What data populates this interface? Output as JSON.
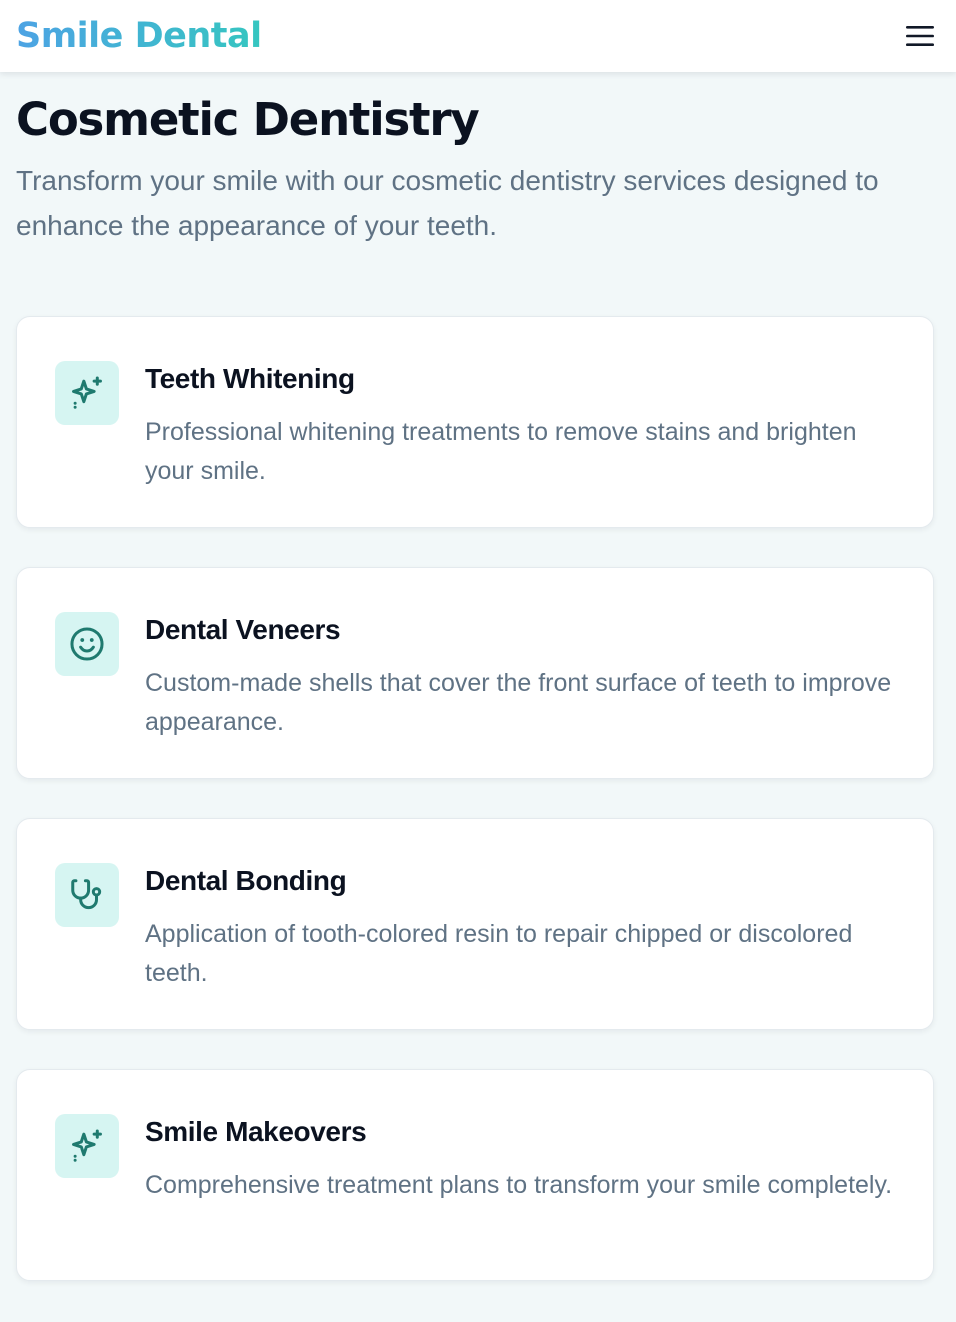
{
  "header": {
    "brand": "Smile Dental",
    "menu_icon": "hamburger-menu-icon"
  },
  "page": {
    "title": "Cosmetic Dentistry",
    "subtitle": "Transform your smile with our cosmetic dentistry services designed to enhance the appearance of your teeth."
  },
  "services": [
    {
      "icon": "sparkles-icon",
      "title": "Teeth Whitening",
      "description": "Professional whitening treatments to remove stains and brighten your smile."
    },
    {
      "icon": "smile-icon",
      "title": "Dental Veneers",
      "description": "Custom-made shells that cover the front surface of teeth to improve appearance."
    },
    {
      "icon": "stethoscope-icon",
      "title": "Dental Bonding",
      "description": "Application of tooth-colored resin to repair chipped or discolored teeth."
    },
    {
      "icon": "sparkles-icon",
      "title": "Smile Makeovers",
      "description": "Comprehensive treatment plans to transform your smile completely."
    }
  ],
  "colors": {
    "brand_gradient_start": "#4da3e4",
    "brand_gradient_end": "#35c6c0",
    "icon_color": "#1f7a6f",
    "icon_background": "#d6f5f2",
    "page_background": "#f2f8f9"
  }
}
